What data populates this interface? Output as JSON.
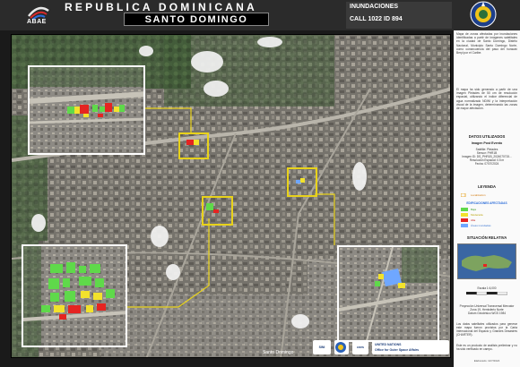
{
  "header": {
    "logo_text": "ABAE",
    "country": "REPUBLICA DOMINICANA",
    "city": "SANTO DOMINGO",
    "event_type": "INUNDACIONES",
    "call_id": "CALL 1022 ID 894"
  },
  "panel": {
    "intro": "Mapa de zonas afectadas por inundaciones identificadas a partir de imágenes satelitales en la ciudad de Santo Domingo, Distrito Nacional, Municipio Santo Domingo Norte, como consecuencia del paso del huracán Beryl por el Caribe.",
    "intro2": "El mapa ha sido generado a partir de una imagen Pleiades de 50 cm de resolución espacial, utilizando el índice diferencial de agua normalizado NDWI y la interpretación visual de la imagen, determinando las zonas de mayor afectación.",
    "data_title": "DATOS UTILIZADOS",
    "post_event_title": "Imagen Post Evento",
    "post_event_lines": [
      "Satélite: Pleiades",
      "Sensor: PHR1B",
      "Imagen ID: DS_PHR1B_2024070715...",
      "Resolución Espacial: 0.5 m",
      "Fecha: 07/07/2024"
    ],
    "legend_title": "LEYENDA",
    "location_label": "Localización",
    "affected_title": "EDIFICACIONES AFECTADAS",
    "legend_items": [
      {
        "label": "Baja",
        "color": "#5fd94a"
      },
      {
        "label": "Moderada",
        "color": "#f2e22c"
      },
      {
        "label": "Alta",
        "color": "#e52421"
      },
      {
        "label": "Áreas inundadas",
        "color": "#6fa7ff"
      }
    ],
    "relative_title": "SITUACIÓN RELATIVA",
    "scale_text": "Escala 1:6,000",
    "projection_lines": [
      "Proyección Universal Transversal Mercator",
      "Zona 19, Hemisferio Norte",
      "Datum Geodésico WGS 1984"
    ],
    "disclaimer": "Los datos satelitales utilizados para generar este mapa fueron provistos por la Carta Internacional del Espacio y Grandes Desastres (CHARTER).",
    "disclaimer2": "Este es un producto de análisis preliminar y no ha sido verificado en campo.",
    "footer": "Elaborado: 11/7/2024"
  },
  "map": {
    "place_label": "Santo Domingo"
  },
  "logos": {
    "un_line1": "UNITED NATIONS",
    "un_line2": "Office for Outer Space Affairs"
  }
}
